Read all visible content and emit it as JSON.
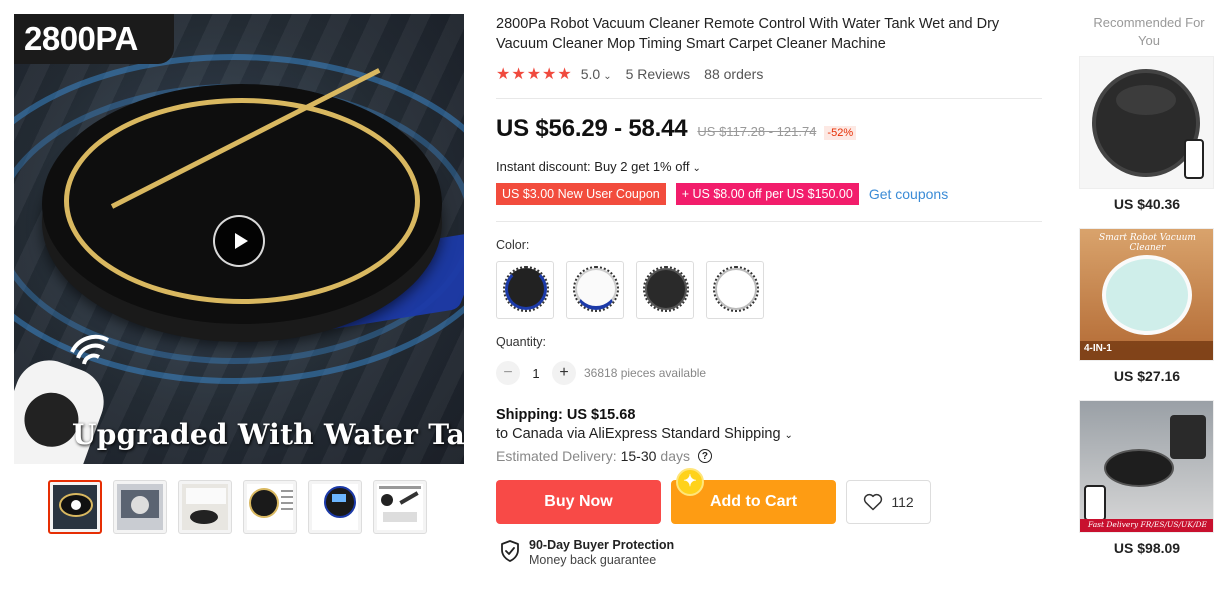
{
  "main_image": {
    "badge": "2800PA",
    "caption": "Upgraded With Water Tank"
  },
  "thumbnails": [
    {
      "label": "Video cover"
    },
    {
      "label": "Product in room"
    },
    {
      "label": "Product on floor"
    },
    {
      "label": "Black model"
    },
    {
      "label": "Features"
    },
    {
      "label": "Product configuration"
    }
  ],
  "product": {
    "title": "2800Pa Robot Vacuum Cleaner Remote Control With Water Tank Wet and Dry Vacuum Cleaner Mop Timing Smart Carpet Cleaner Machine",
    "stars": "★★★★★",
    "rating": "5.0",
    "reviews": "5 Reviews",
    "orders": "88 orders",
    "price": "US $56.29 - 58.44",
    "original_price": "US $117.28 - 121.74",
    "discount": "-52%",
    "instant_discount": "Instant discount: Buy 2 get 1% off",
    "coupons": [
      "US $3.00 New User Coupon",
      "+ US $8.00 off per US $150.00"
    ],
    "get_coupons": "Get coupons",
    "color_label": "Color:",
    "quantity_label": "Quantity:",
    "quantity": "1",
    "pieces_available": "36818 pieces available",
    "shipping_title": "Shipping: US $15.68",
    "shipping_line": "to Canada via AliExpress Standard Shipping",
    "delivery_label": "Estimated Delivery:",
    "delivery_range": "15-30",
    "delivery_unit": "days",
    "buy_now": "Buy Now",
    "add_to_cart": "Add to Cart",
    "wishlist_count": "112",
    "protection_title": "90-Day Buyer Protection",
    "protection_sub": "Money back guarantee"
  },
  "recommended": {
    "heading": "Recommended For You",
    "items": [
      {
        "price": "US $40.36"
      },
      {
        "price": "US $27.16",
        "banner": "Smart Robot Vacuum Cleaner",
        "tag": "4-IN-1"
      },
      {
        "price": "US $98.09",
        "banner": "Fast Delivery FR/ES/US/UK/DE"
      }
    ]
  },
  "colors": {
    "accent_red": "#f84a47",
    "accent_orange": "#fe9c13",
    "link_blue": "#3a8bd6",
    "star_red": "#f04a3e"
  }
}
